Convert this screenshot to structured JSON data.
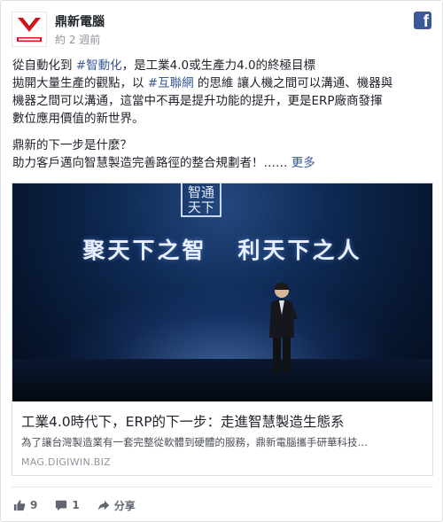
{
  "post": {
    "page_name": "鼎新電腦",
    "timestamp": "約 2 週前",
    "avatar_logo": "鼎新電腦 logo",
    "lines": [
      {
        "before": "從自動化到 ",
        "tag": "#智動化",
        "after": "，是工業4.0或生產力4.0的終極目標"
      },
      {
        "before": "拋開大量生產的觀點，以 ",
        "tag": "#互聯網",
        "after": " 的思維 讓人機之間可以溝通、機器與"
      },
      {
        "before": "機器之間可以溝通，這當中不再是提升功能的提升，更是ERP廠商發揮",
        "tag": "",
        "after": ""
      },
      {
        "before": "數位應用價值的新世界。",
        "tag": "",
        "after": ""
      }
    ],
    "line5": "鼎新的下一步是什麼？",
    "line6": "助力客戶邁向智慧製造完善路徑的整合規劃者！…… ",
    "more_label": "更多"
  },
  "link_preview": {
    "banner_text": "聚天下之智   利天下之人",
    "badge_text": "智通天下",
    "title": "工業4.0時代下，ERP的下一步：走進智慧製造生態系",
    "description": "為了讓台灣製造業有一套完整從軟體到硬體的服務，鼎新電腦攜手研華科技…",
    "domain": "MAG.DIGIWIN.BIZ"
  },
  "footer": {
    "likes": "9",
    "comments": "1",
    "share_label": "分享"
  },
  "icons": {
    "facebook": "facebook-icon",
    "like": "thumbs-up-icon",
    "comment": "comment-icon",
    "share": "share-arrow-icon"
  },
  "colors": {
    "link": "#365899",
    "facebook_blue": "#3b5998",
    "brand_red": "#d7141a",
    "muted": "#90949c"
  }
}
